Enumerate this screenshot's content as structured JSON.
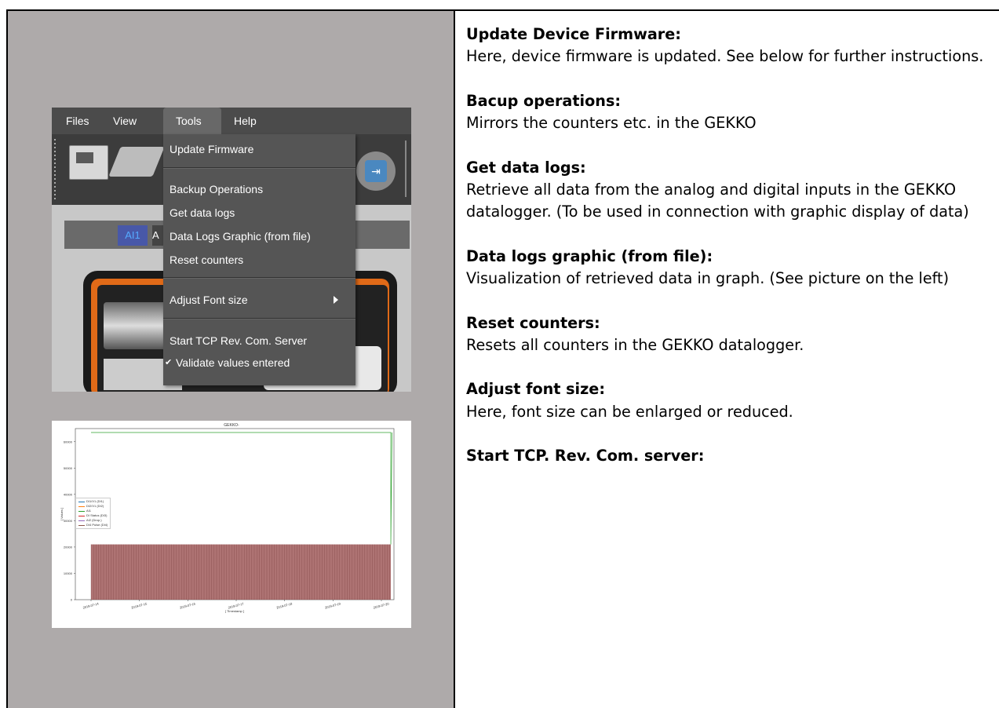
{
  "left_panel": {
    "screenshot_menu": {
      "menubar": [
        "Files",
        "View",
        "Tools",
        "Help"
      ],
      "active_menu": "Tools",
      "dropdown_items": [
        {
          "label": "Update Firmware",
          "checked": false,
          "submenu": false
        },
        {
          "label": "Backup Operations",
          "checked": false,
          "submenu": false
        },
        {
          "label": "Get data logs",
          "checked": false,
          "submenu": false
        },
        {
          "label": "Data Logs Graphic (from file)",
          "checked": false,
          "submenu": false
        },
        {
          "label": "Reset counters",
          "checked": false,
          "submenu": false
        },
        {
          "label": "Adjust Font size",
          "checked": false,
          "submenu": true
        },
        {
          "label": "Start TCP Rev. Com. Server",
          "checked": false,
          "submenu": false
        },
        {
          "label": "Validate values entered",
          "checked": true,
          "submenu": false
        }
      ],
      "tab_label": "AI1",
      "tab_label_partial": "A"
    },
    "screenshot_chart": {
      "chart_data": {
        "type": "line",
        "title": "GEKKO-",
        "xlabel": "[ Timestamp ]",
        "ylabel": "[ Values ]",
        "x_ticks": [
          "2019-07-14",
          "2019-07-15",
          "2019-07-16",
          "2019-07-17",
          "2019-07-18",
          "2019-07-19",
          "2019-07-20"
        ],
        "y_ticks": [
          "0",
          "10000",
          "20000",
          "30000",
          "40000",
          "50000",
          "60000"
        ],
        "ylim": [
          0,
          65000
        ],
        "legend_placement": "center-left",
        "series": [
          {
            "name": "DI1/V1 (DI1)",
            "color": "#1f77b4",
            "values_note": ""
          },
          {
            "name": "DI2/V1 (DI2)",
            "color": "#ff7f0e"
          },
          {
            "name": "AI1",
            "color": "#2ca02c"
          },
          {
            "name": "DI Status (DI3)",
            "color": "#d62728"
          },
          {
            "name": "AI2 (Drop.)",
            "color": "#9467bd"
          },
          {
            "name": "DI4 Pulse (DI4)",
            "color": "#8c564b"
          }
        ],
        "levels": {
          "flat_top": 63500,
          "band_top": 21000,
          "band_bottom": 0
        },
        "band_color": "#a05a5a",
        "line_color": "#2ca02c"
      }
    }
  },
  "right_panel": {
    "sections": [
      {
        "heading": "Update Device Firmware:",
        "text": "Here, device firmware is updated. See below for further instructions."
      },
      {
        "heading": "Bacup operations:",
        "text": "Mirrors the counters etc. in the GEKKO"
      },
      {
        "heading": "Get data logs:",
        "text": "Retrieve all data from the analog and digital inputs in the GEKKO datalogger. (To be used in connection with graphic display of data)"
      },
      {
        "heading": "Data logs graphic (from file):",
        "text": "Visualization of retrieved data in graph. (See picture on the left)"
      },
      {
        "heading": "Reset counters:",
        "text": "Resets all counters in the GEKKO datalogger."
      },
      {
        "heading": "Adjust font size:",
        "text": "Here, font size can be enlarged or reduced."
      },
      {
        "heading": "Start TCP. Rev. Com. server:",
        "text": ""
      }
    ]
  }
}
